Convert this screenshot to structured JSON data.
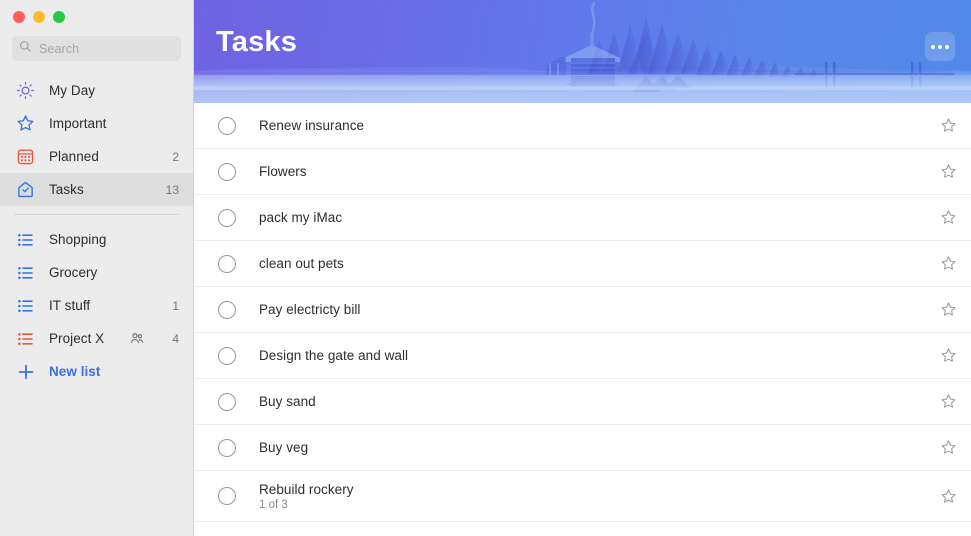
{
  "window": {
    "traffic_lights": [
      "close",
      "minimize",
      "zoom"
    ]
  },
  "search": {
    "placeholder": "Search",
    "value": "",
    "icon": "search-icon"
  },
  "sidebar": {
    "smart_lists": [
      {
        "label": "My Day",
        "icon": "sun-icon",
        "count": "",
        "selected": false
      },
      {
        "label": "Important",
        "icon": "star-icon",
        "count": "",
        "selected": false
      },
      {
        "label": "Planned",
        "icon": "calendar-icon",
        "count": "2",
        "selected": false
      },
      {
        "label": "Tasks",
        "icon": "house-check-icon",
        "count": "13",
        "selected": true
      }
    ],
    "custom_lists": [
      {
        "label": "Shopping",
        "icon": "list-icon",
        "count": "",
        "shared": false
      },
      {
        "label": "Grocery",
        "icon": "list-icon",
        "count": "",
        "shared": false
      },
      {
        "label": "IT stuff",
        "icon": "list-icon",
        "count": "1",
        "shared": false
      },
      {
        "label": "Project X",
        "icon": "list-icon-red",
        "count": "4",
        "shared": true
      }
    ],
    "new_list": {
      "label": "New list",
      "icon": "plus-icon"
    }
  },
  "header": {
    "title": "Tasks",
    "more_button": "more-options-icon",
    "gradient_start": "#6f63e2",
    "gradient_end": "#5189e8"
  },
  "tasks": [
    {
      "title": "Renew insurance",
      "subtitle": "",
      "done": false,
      "starred": false
    },
    {
      "title": "Flowers",
      "subtitle": "",
      "done": false,
      "starred": false
    },
    {
      "title": "pack my iMac",
      "subtitle": "",
      "done": false,
      "starred": false
    },
    {
      "title": "clean out pets",
      "subtitle": "",
      "done": false,
      "starred": false
    },
    {
      "title": "Pay electricty bill",
      "subtitle": "",
      "done": false,
      "starred": false
    },
    {
      "title": "Design the gate and wall",
      "subtitle": "",
      "done": false,
      "starred": false
    },
    {
      "title": "Buy sand",
      "subtitle": "",
      "done": false,
      "starred": false
    },
    {
      "title": "Buy veg",
      "subtitle": "",
      "done": false,
      "starred": false
    },
    {
      "title": "Rebuild rockery",
      "subtitle": "1 of 3",
      "done": false,
      "starred": false
    }
  ],
  "colors": {
    "accent_blue": "#3b6fe0",
    "accent_purple": "#7a5cd6",
    "accent_red": "#e8563f",
    "sidebar_bg": "#ececec",
    "selected_bg": "#dddddd"
  }
}
